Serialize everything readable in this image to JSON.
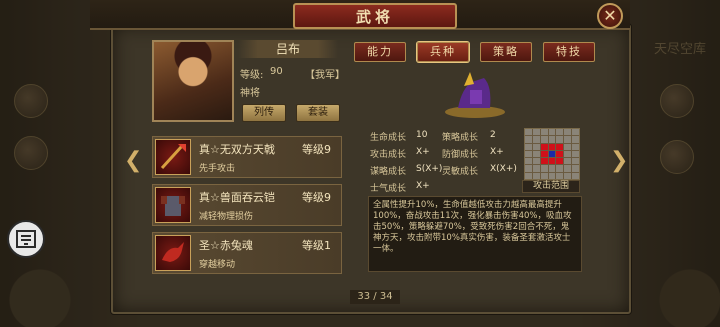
{
  "title": "武将",
  "close_label": "✕",
  "background": {
    "right_text": "天尽空库"
  },
  "hero": {
    "name": "吕布",
    "level_label": "等级:",
    "level": "90",
    "faction": "【我军】",
    "role": "神将",
    "bio_button": "列传",
    "suit_button": "套装"
  },
  "tabs": [
    {
      "label": "能力",
      "active": false
    },
    {
      "label": "兵种",
      "active": true
    },
    {
      "label": "策略",
      "active": false
    },
    {
      "label": "特技",
      "active": false
    }
  ],
  "equipment": [
    {
      "name": "真☆无双方天戟",
      "level_label": "等级",
      "level": "9",
      "desc": "先手攻击",
      "icon": "halberd-icon"
    },
    {
      "name": "真☆兽面吞云铠",
      "level_label": "等级",
      "level": "9",
      "desc": "减轻物理损伤",
      "icon": "armor-icon"
    },
    {
      "name": "圣☆赤兔魂",
      "level_label": "等级",
      "level": "1",
      "desc": "穿越移动",
      "icon": "red-hare-icon"
    }
  ],
  "stats": {
    "hp_growth_label": "生命成长",
    "hp_growth": "10",
    "strategy_growth_label": "策略成长",
    "strategy_growth": "2",
    "attack_growth_label": "攻击成长",
    "attack_growth": "X+",
    "defense_growth_label": "防御成长",
    "defense_growth": "X+",
    "intellect_growth_label": "谋略成长",
    "intellect_growth": "S(X+)",
    "agility_growth_label": "灵敏成长",
    "agility_growth": "X(X+)",
    "morale_growth_label": "士气成长",
    "morale_growth": "X+"
  },
  "attack_range_label": "攻击范围",
  "description": "全属性提升10%，生命值越低攻击力越高最高提升100%，奋战攻击11次，强化暴击伤害40%，吸血攻击50%，策略躲避70%，受致死伤害2回合不死，鬼神方天，攻击附带10%真实伤害，装备圣套激活攻士一体。",
  "pagination": "33 / 34",
  "colors": {
    "panel": "#3d3628",
    "title_red": "#8c2b1f",
    "gold_border": "#b89154",
    "range_red": "#d0101a",
    "range_blue": "#1a2aa8"
  }
}
